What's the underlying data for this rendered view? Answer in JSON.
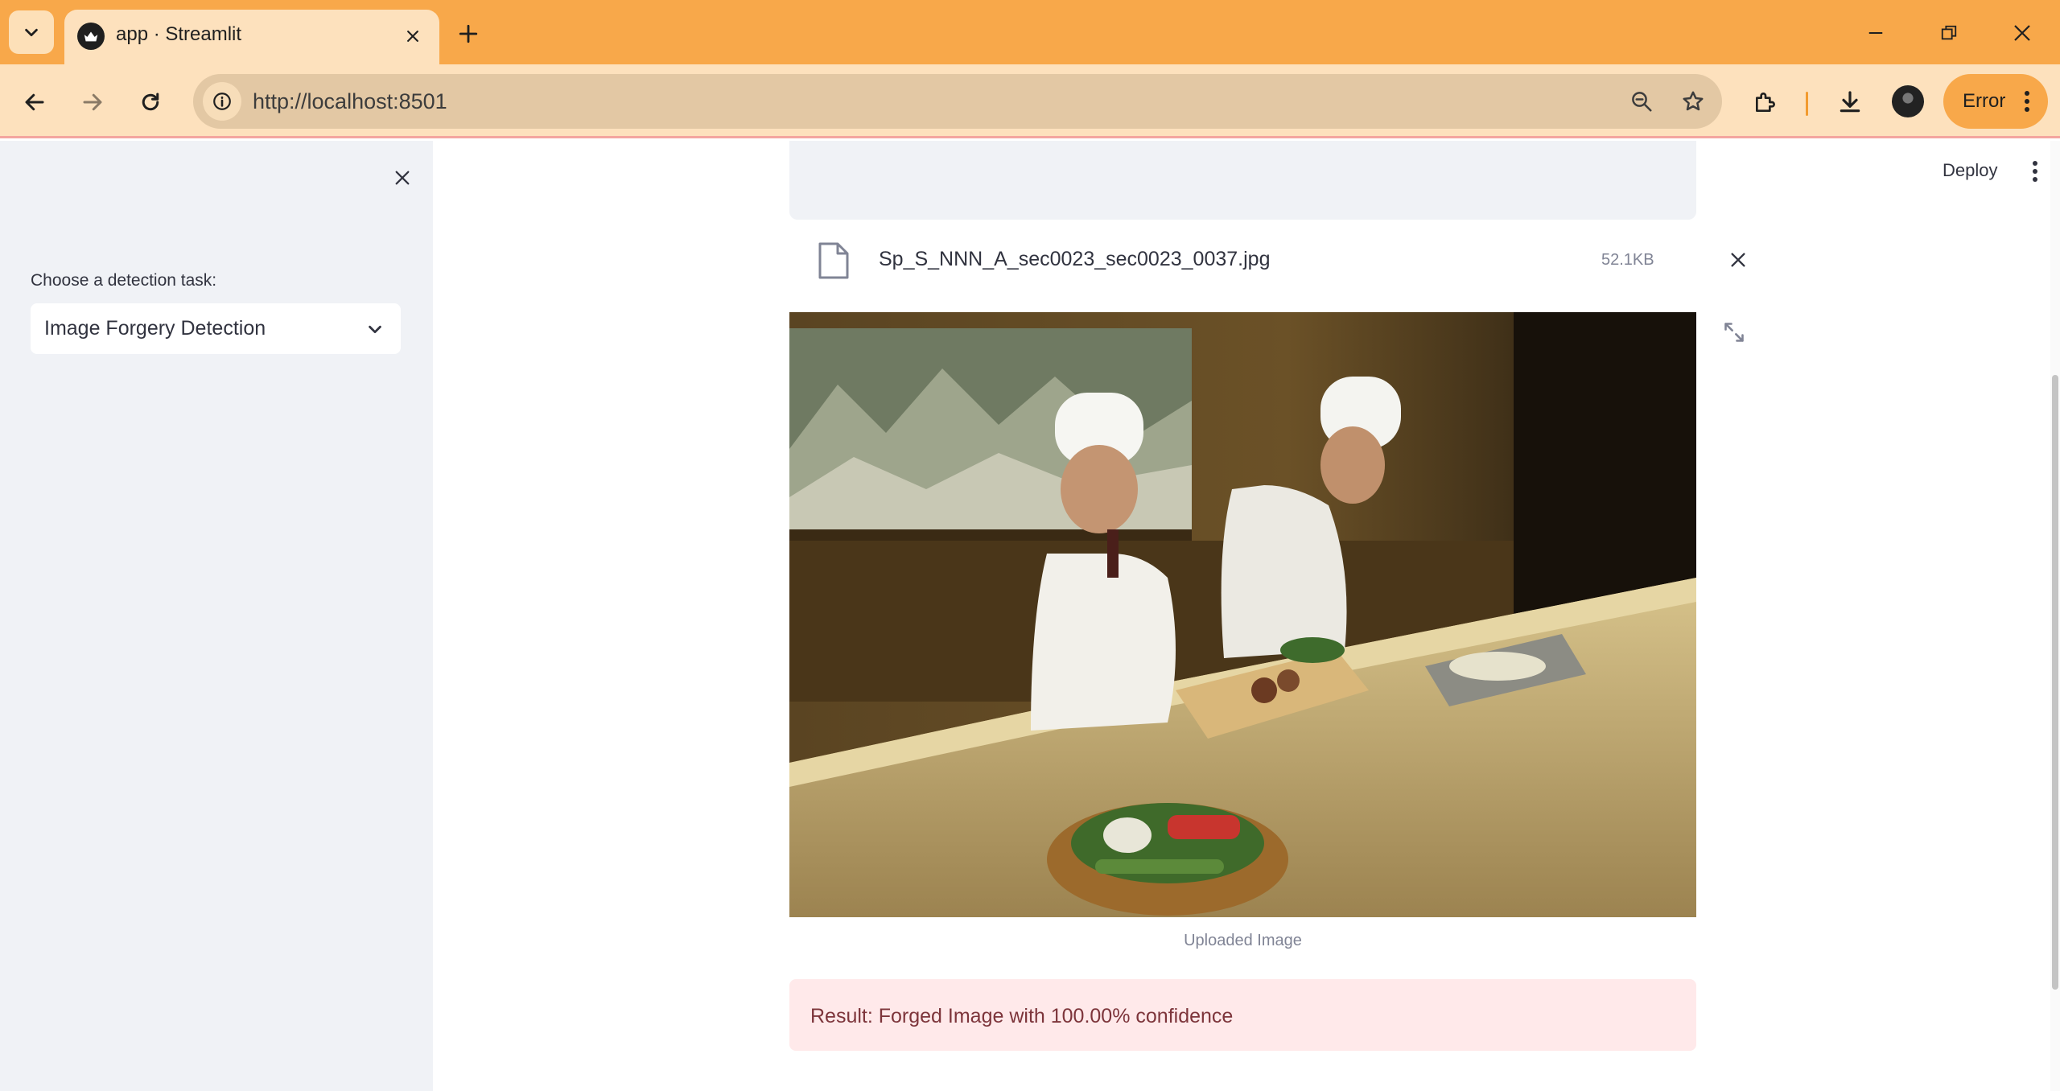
{
  "browser": {
    "tab_title": "app · Streamlit",
    "url": "http://localhost:8501",
    "profile_status": "Error",
    "colors": {
      "frame": "#f8a84a",
      "toolbar": "#fde1bd",
      "omnibox": "#e3c8a4"
    }
  },
  "sidebar": {
    "select_label": "Choose a detection task:",
    "select_value": "Image Forgery Detection"
  },
  "header": {
    "deploy_label": "Deploy"
  },
  "upload": {
    "file_name": "Sp_S_NNN_A_sec0023_sec0023_0037.jpg",
    "file_size": "52.1KB"
  },
  "image": {
    "caption": "Uploaded Image"
  },
  "result": {
    "text": "Result: Forged Image with 100.00% confidence",
    "colors": {
      "background": "#ffe9ea",
      "text": "#7d353b"
    }
  }
}
